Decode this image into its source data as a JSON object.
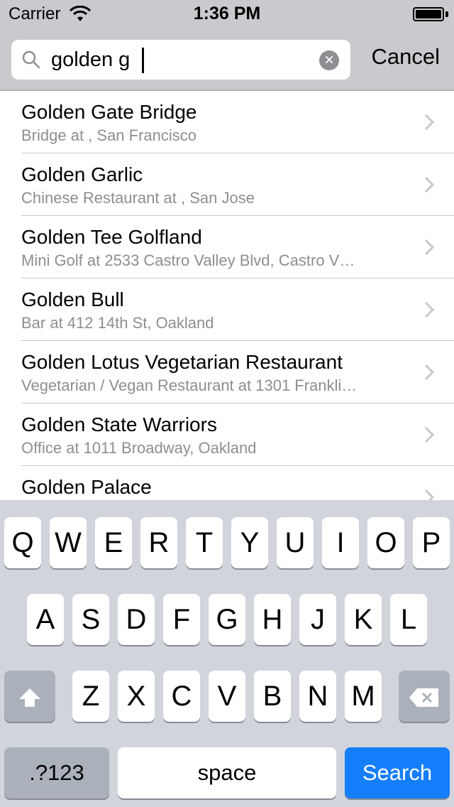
{
  "status_bar": {
    "carrier": "Carrier",
    "time": "1:36 PM",
    "battery_level": 1.0
  },
  "search": {
    "value": "golden g",
    "cancel_label": "Cancel"
  },
  "results": [
    {
      "title": "Golden Gate Bridge",
      "subtitle": "Bridge at , San Francisco"
    },
    {
      "title": "Golden Garlic",
      "subtitle": "Chinese Restaurant at , San Jose"
    },
    {
      "title": "Golden Tee Golfland",
      "subtitle": "Mini Golf at 2533 Castro Valley Blvd, Castro V…"
    },
    {
      "title": "Golden Bull",
      "subtitle": "Bar at 412 14th St, Oakland"
    },
    {
      "title": "Golden Lotus Vegetarian Restaurant",
      "subtitle": "Vegetarian / Vegan Restaurant at 1301 Frankli…"
    },
    {
      "title": "Golden State Warriors",
      "subtitle": "Office at 1011 Broadway, Oakland"
    },
    {
      "title": "Golden Palace",
      "subtitle": ""
    }
  ],
  "keyboard": {
    "row1": [
      "Q",
      "W",
      "E",
      "R",
      "T",
      "Y",
      "U",
      "I",
      "O",
      "P"
    ],
    "row2": [
      "A",
      "S",
      "D",
      "F",
      "G",
      "H",
      "J",
      "K",
      "L"
    ],
    "row3": [
      "Z",
      "X",
      "C",
      "V",
      "B",
      "N",
      "M"
    ],
    "numbers_label": ".?123",
    "space_label": "space",
    "search_label": "Search"
  },
  "colors": {
    "accent": "#157efb",
    "bar_background": "#c9c9ce",
    "keyboard_background": "#d1d5db",
    "subtitle_gray": "#8e8e93"
  }
}
